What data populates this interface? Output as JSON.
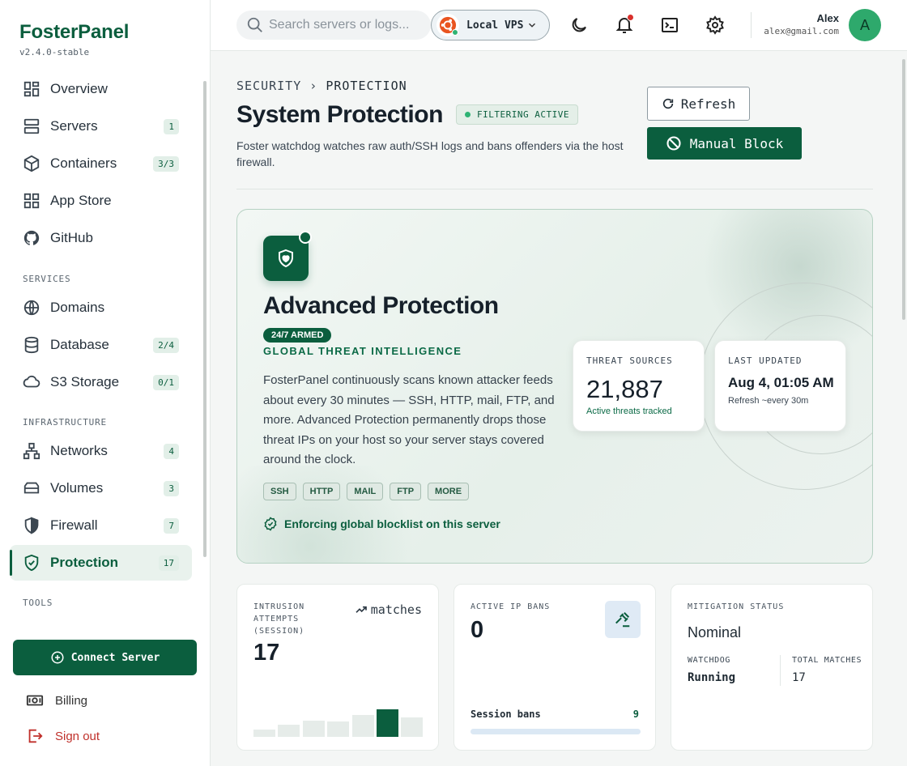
{
  "brand": {
    "name": "FosterPanel",
    "version": "v2.4.0-stable"
  },
  "sidebar": {
    "items": [
      {
        "label": "Overview",
        "icon": "grid-icon",
        "badge": ""
      },
      {
        "label": "Servers",
        "icon": "server-icon",
        "badge": "1"
      },
      {
        "label": "Containers",
        "icon": "cube-icon",
        "badge": "3/3"
      },
      {
        "label": "App Store",
        "icon": "apps-icon",
        "badge": ""
      },
      {
        "label": "GitHub",
        "icon": "github-icon",
        "badge": ""
      }
    ],
    "services_label": "SERVICES",
    "services": [
      {
        "label": "Domains",
        "icon": "globe-icon",
        "badge": ""
      },
      {
        "label": "Database",
        "icon": "database-icon",
        "badge": "2/4"
      },
      {
        "label": "S3 Storage",
        "icon": "cloud-icon",
        "badge": "0/1"
      }
    ],
    "infrastructure_label": "INFRASTRUCTURE",
    "infrastructure": [
      {
        "label": "Networks",
        "icon": "network-icon",
        "badge": "4"
      },
      {
        "label": "Volumes",
        "icon": "drive-icon",
        "badge": "3"
      },
      {
        "label": "Firewall",
        "icon": "shield-icon",
        "badge": "7"
      },
      {
        "label": "Protection",
        "icon": "shield-check-icon",
        "badge": "17"
      }
    ],
    "tools_label": "TOOLS",
    "connect_button": "Connect Server",
    "billing": "Billing",
    "signout": "Sign out"
  },
  "topbar": {
    "search_placeholder": "Search servers or logs...",
    "server_selector": "Local VPS",
    "user_name": "Alex",
    "user_email": "alex@gmail.com",
    "avatar_initial": "A"
  },
  "page": {
    "breadcrumb_parent": "SECURITY",
    "breadcrumb_sep": "›",
    "breadcrumb_current": "PROTECTION",
    "title": "System Protection",
    "status_badge": "FILTERING ACTIVE",
    "description": "Foster watchdog watches raw auth/SSH logs and bans offenders via the host firewall.",
    "refresh_label": "Refresh",
    "manual_block_label": "Manual Block"
  },
  "hero": {
    "title": "Advanced Protection",
    "armed_badge": "24/7 ARMED",
    "subtitle": "GLOBAL THREAT INTELLIGENCE",
    "description": "FosterPanel continuously scans known attacker feeds about every 30 minutes — SSH, HTTP, mail, FTP, and more. Advanced Protection permanently drops those threat IPs on your host so your server stays covered around the clock.",
    "tags": [
      "SSH",
      "HTTP",
      "MAIL",
      "FTP",
      "MORE"
    ],
    "enforce_text": "Enforcing global blocklist on this server",
    "threat_sources_label": "THREAT SOURCES",
    "threat_sources_value": "21,887",
    "threat_sources_sub": "Active threats tracked",
    "last_updated_label": "LAST UPDATED",
    "last_updated_value": "Aug 4, 01:05 AM",
    "last_updated_sub": "Refresh ~every 30m"
  },
  "cards": {
    "intrusion": {
      "label_lines": [
        "INTRUSION",
        "ATTEMPTS",
        "(SESSION)"
      ],
      "trend_label": "matches",
      "value": "17",
      "bars": [
        0.25,
        0.45,
        0.6,
        0.55,
        0.8,
        1.0,
        0.7
      ],
      "highlight_index": 5
    },
    "bans": {
      "label": "ACTIVE IP BANS",
      "value": "0",
      "session_label": "Session bans",
      "session_value": "9",
      "session_fraction": 0
    },
    "mitigation": {
      "label": "MITIGATION STATUS",
      "value": "Nominal",
      "watchdog_label": "WATCHDOG",
      "watchdog_value": "Running",
      "matches_label": "TOTAL MATCHES",
      "matches_value": "17"
    }
  },
  "colors": {
    "primary": "#0b5e3e",
    "accent": "#2fb374",
    "danger": "#d9302c"
  }
}
